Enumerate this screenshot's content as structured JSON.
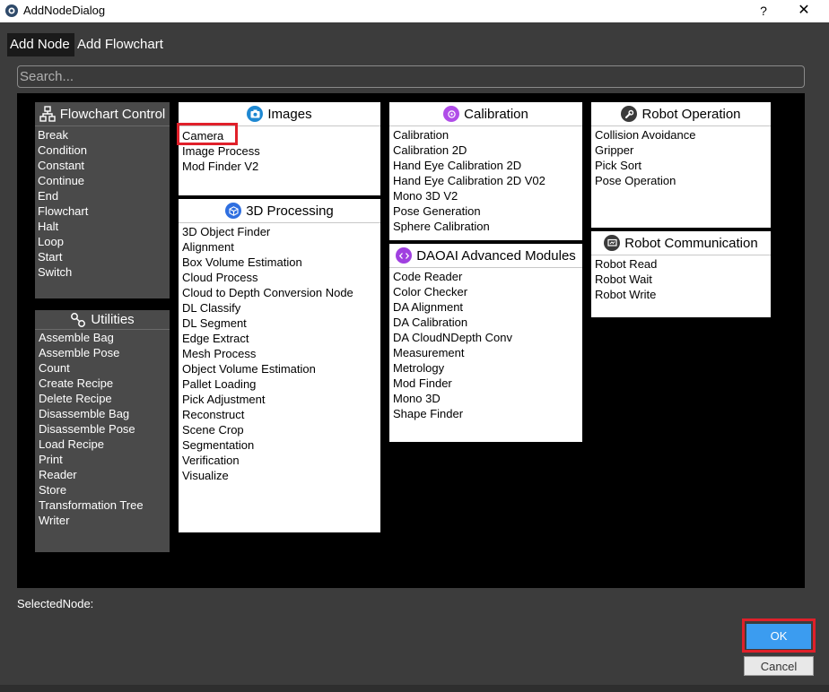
{
  "window": {
    "title": "AddNodeDialog",
    "help_button": "?",
    "close_button": "✕"
  },
  "tabs": [
    {
      "label": "Add Node",
      "active": true
    },
    {
      "label": "Add Flowchart",
      "active": false
    }
  ],
  "search": {
    "placeholder": "Search..."
  },
  "panels": {
    "flowchart_control": {
      "title": "Flowchart Control",
      "icon": "flowchart-icon",
      "items": [
        "Break",
        "Condition",
        "Constant",
        "Continue",
        "End",
        "Flowchart",
        "Halt",
        "Loop",
        "Start",
        "Switch"
      ]
    },
    "utilities": {
      "title": "Utilities",
      "icon": "utilities-icon",
      "items": [
        "Assemble Bag",
        "Assemble Pose",
        "Count",
        "Create Recipe",
        "Delete Recipe",
        "Disassemble Bag",
        "Disassemble Pose",
        "Load Recipe",
        "Print",
        "Reader",
        "Store",
        "Transformation Tree",
        "Writer"
      ]
    },
    "images": {
      "title": "Images",
      "icon": "camera-icon",
      "items": [
        "Camera",
        "Image Process",
        "Mod Finder V2"
      ]
    },
    "processing_3d": {
      "title": "3D Processing",
      "icon": "cube-icon",
      "items": [
        "3D Object Finder",
        "Alignment",
        "Box Volume Estimation",
        "Cloud Process",
        "Cloud to Depth Conversion Node",
        "DL Classify",
        "DL Segment",
        "Edge Extract",
        "Mesh Process",
        "Object Volume Estimation",
        "Pallet Loading",
        "Pick Adjustment",
        "Reconstruct",
        "Scene Crop",
        "Segmentation",
        "Verification",
        "Visualize"
      ]
    },
    "calibration": {
      "title": "Calibration",
      "icon": "target-icon",
      "items": [
        "Calibration",
        "Calibration 2D",
        "Hand Eye Calibration 2D",
        "Hand Eye Calibration 2D V02",
        "Mono 3D V2",
        "Pose Generation",
        "Sphere Calibration"
      ]
    },
    "daoai_advanced": {
      "title": "DAOAI Advanced Modules",
      "icon": "code-icon",
      "items": [
        "Code Reader",
        "Color Checker",
        "DA Alignment",
        "DA Calibration",
        "DA CloudNDepth Conv",
        "Measurement",
        "Metrology",
        "Mod Finder",
        "Mono 3D",
        "Shape Finder"
      ]
    },
    "robot_operation": {
      "title": "Robot Operation",
      "icon": "wrench-icon",
      "items": [
        "Collision Avoidance",
        "Gripper",
        "Pick Sort",
        "Pose Operation"
      ]
    },
    "robot_communication": {
      "title": "Robot Communication",
      "icon": "screen-icon",
      "items": [
        "Robot Read",
        "Robot Wait",
        "Robot Write"
      ]
    }
  },
  "selected_node": {
    "label": "SelectedNode:",
    "value": ""
  },
  "buttons": {
    "ok": "OK",
    "cancel": "Cancel"
  },
  "colors": {
    "window_bg": "#3c3c3c",
    "canvas_bg": "#000000",
    "dark_panel": "#4a4a4a",
    "highlight": "#e0202a",
    "ok_button": "#3b9cf0",
    "images_icon": "#1e88d2",
    "cube_icon": "#2f6fe0",
    "calibration_icon": "#b04de8",
    "daoai_icon": "#a040e0",
    "robot_icon": "#3a3a3a"
  }
}
